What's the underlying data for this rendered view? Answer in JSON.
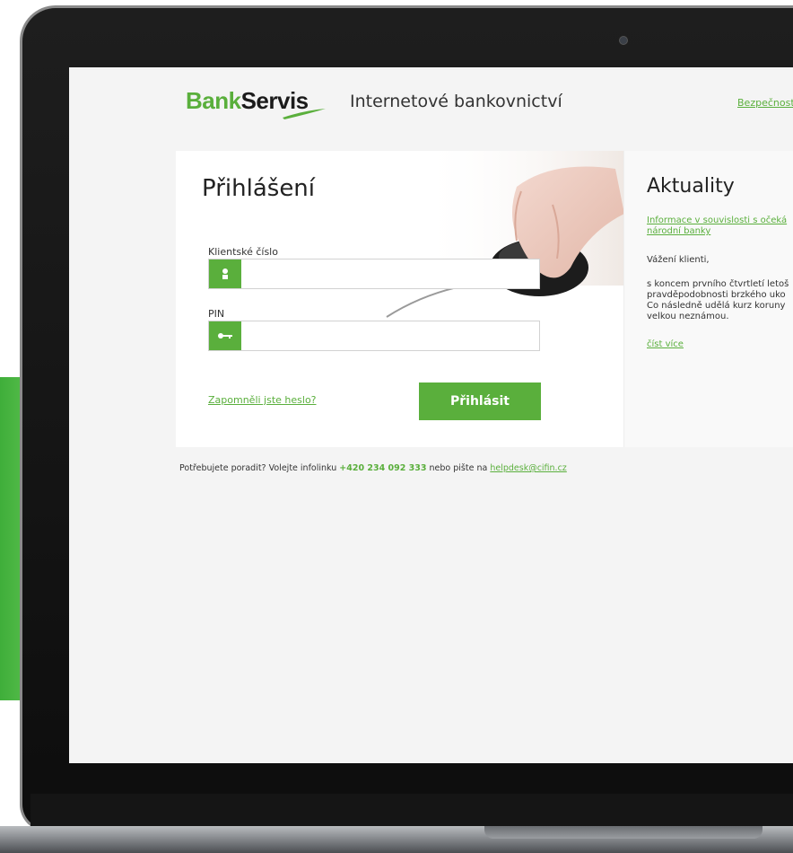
{
  "header": {
    "logo_part1": "Bank",
    "logo_part2": "Servis",
    "app_title": "Internetové bankovnictví",
    "top_link": "Bezpečnost"
  },
  "login": {
    "title": "Přihlášení",
    "client_label": "Klientské číslo",
    "client_value": "",
    "pin_label": "PIN",
    "pin_value": "",
    "forgot_link": "Zapomněli jste heslo?",
    "submit_label": "Přihlásit"
  },
  "news": {
    "title": "Aktuality",
    "link_line1": "Informace v souvislosti s očeká",
    "link_line2": "národní banky",
    "greeting": "Vážení klienti,",
    "body_line1": "s koncem prvního čtvrtletí letoš",
    "body_line2": "pravděpodobnosti brzkého uko",
    "body_line3": "Co následně udělá kurz koruny",
    "body_line4": "velkou neznámou.",
    "more_link": "číst více"
  },
  "help": {
    "text_before": "Potřebujete poradit? Volejte infolinku ",
    "phone": "+420 234 092 333",
    "text_middle": " nebo pište na ",
    "email": "helpdesk@cifin.cz"
  },
  "icons": {
    "client": "user-icon",
    "pin": "key-icon"
  },
  "colors": {
    "brand_green": "#5aaf3c",
    "dark_text": "#1b1b1b"
  }
}
